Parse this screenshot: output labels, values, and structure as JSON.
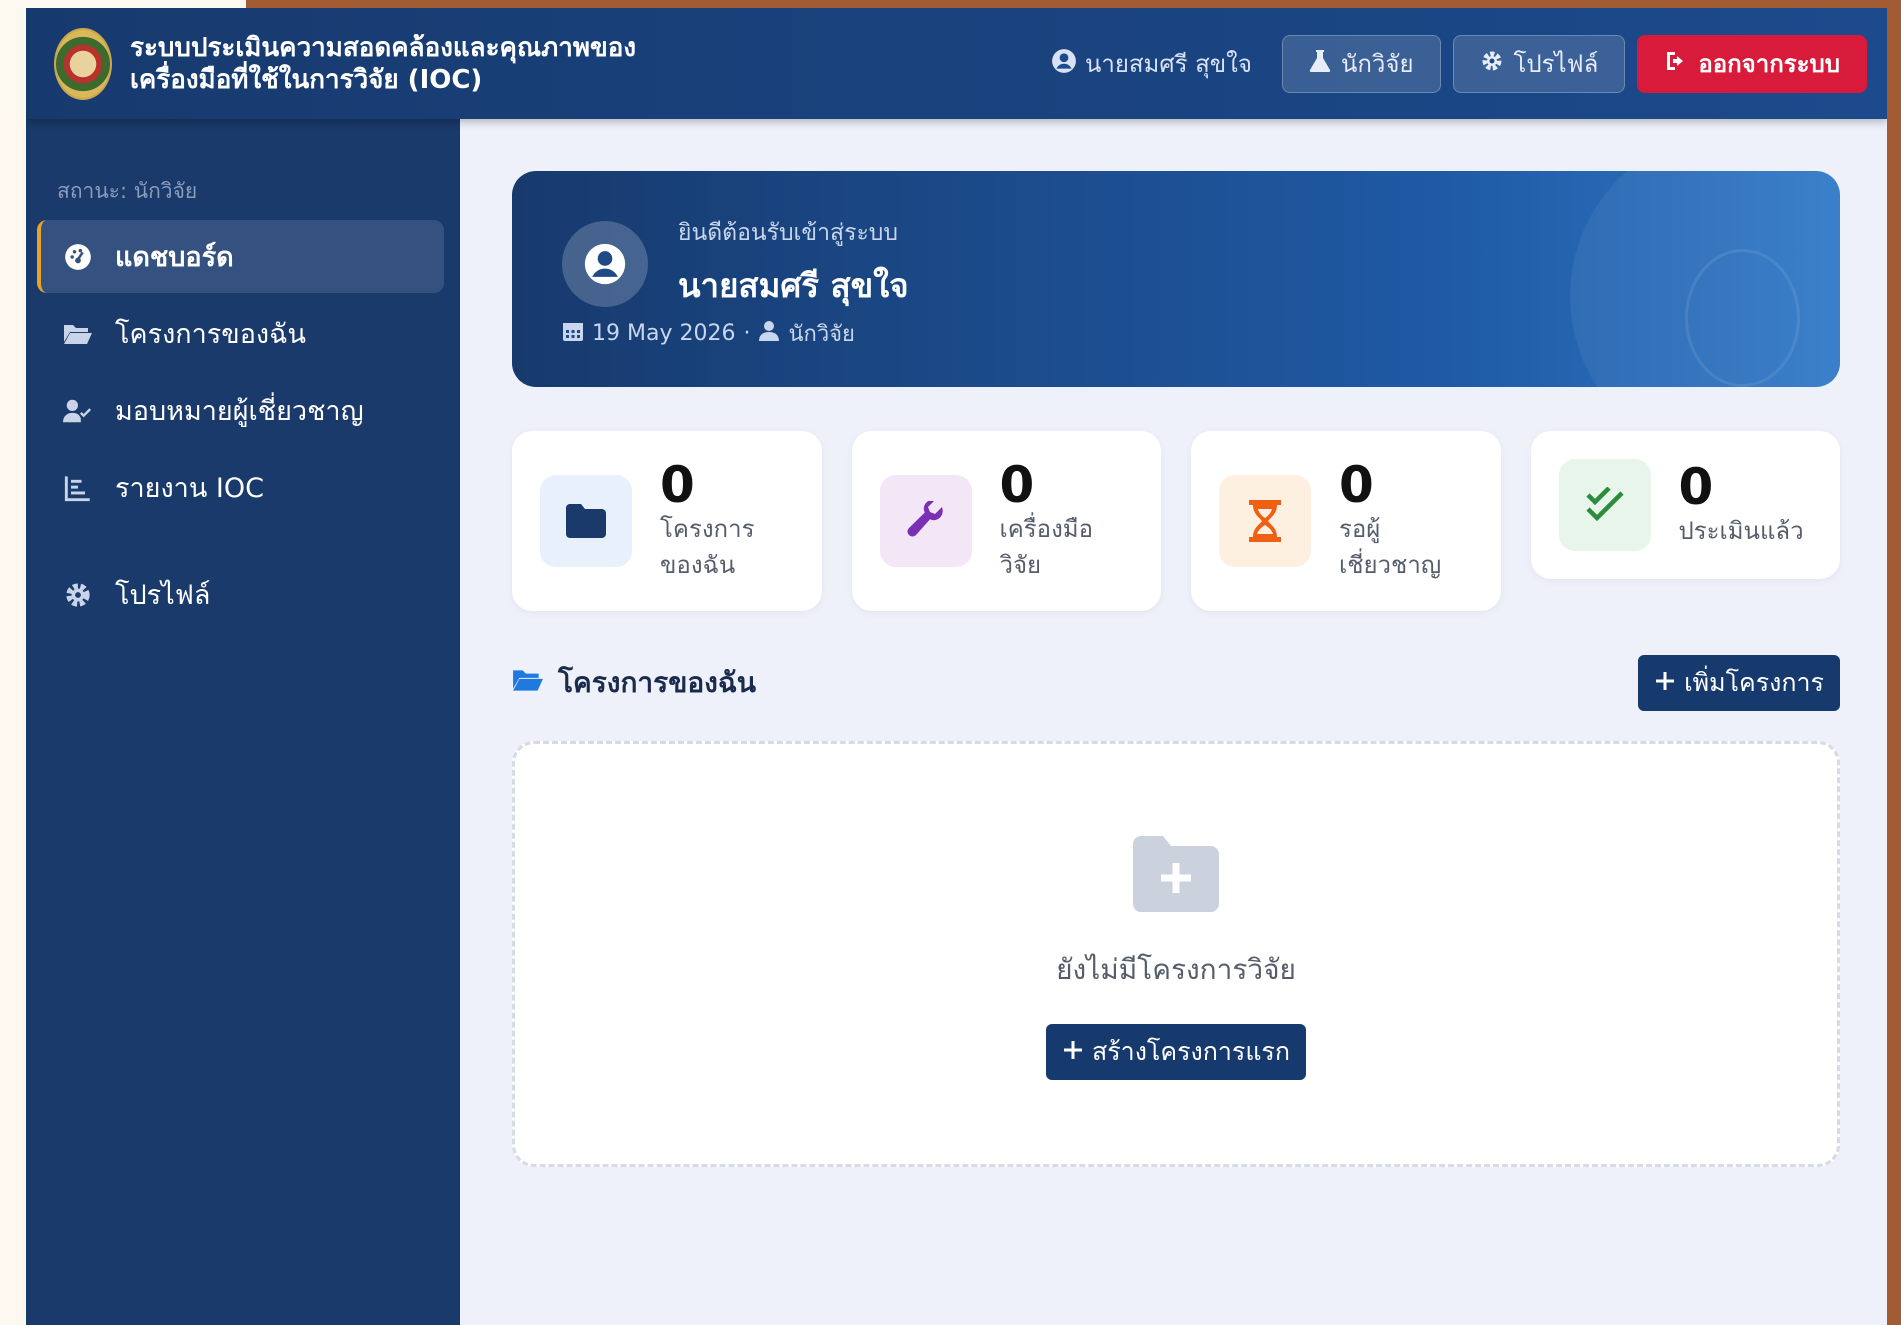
{
  "header": {
    "title": "ระบบประเมินความสอดคล้องและคุณภาพของเครื่องมือที่ใช้ในการวิจัย (IOC)",
    "user_name": "นายสมศรี สุขใจ",
    "role_button": "นักวิจัย",
    "profile_button": "โปรไฟล์",
    "logout_button": "ออกจากระบบ"
  },
  "sidebar": {
    "role_label": "สถานะ: นักวิจัย",
    "items": [
      {
        "label": "แดชบอร์ด",
        "icon": "dashboard-icon",
        "active": true
      },
      {
        "label": "โครงการของฉัน",
        "icon": "folder-open-icon"
      },
      {
        "label": "มอบหมายผู้เชี่ยวชาญ",
        "icon": "user-check-icon"
      },
      {
        "label": "รายงาน IOC",
        "icon": "chart-icon"
      },
      {
        "label": "โปรไฟล์",
        "icon": "gear-icon"
      }
    ]
  },
  "welcome": {
    "greeting": "ยินดีต้อนรับเข้าสู่ระบบ",
    "name": "นายสมศรี สุขใจ",
    "date": "19 May 2026",
    "role": "นักวิจัย"
  },
  "stats": [
    {
      "value": "0",
      "label": "โครงการของฉัน",
      "icon": "folder-icon",
      "color": "#1a3a6b",
      "bg": "#e8f0fb"
    },
    {
      "value": "0",
      "label": "เครื่องมือวิจัย",
      "icon": "wrench-icon",
      "color": "#7b2fb5",
      "bg": "#f3e6f7"
    },
    {
      "value": "0",
      "label": "รอผู้เชี่ยวชาญ",
      "icon": "hourglass-icon",
      "color": "#f06014",
      "bg": "#fdf0e0"
    },
    {
      "value": "0",
      "label": "ประเมินแล้ว",
      "icon": "check-double-icon",
      "color": "#2a8c3c",
      "bg": "#e8f5ea"
    }
  ],
  "projects": {
    "title": "โครงการของฉัน",
    "add_button": "เพิ่มโครงการ",
    "empty_text": "ยังไม่มีโครงการวิจัย",
    "create_button": "สร้างโครงการแรก"
  }
}
